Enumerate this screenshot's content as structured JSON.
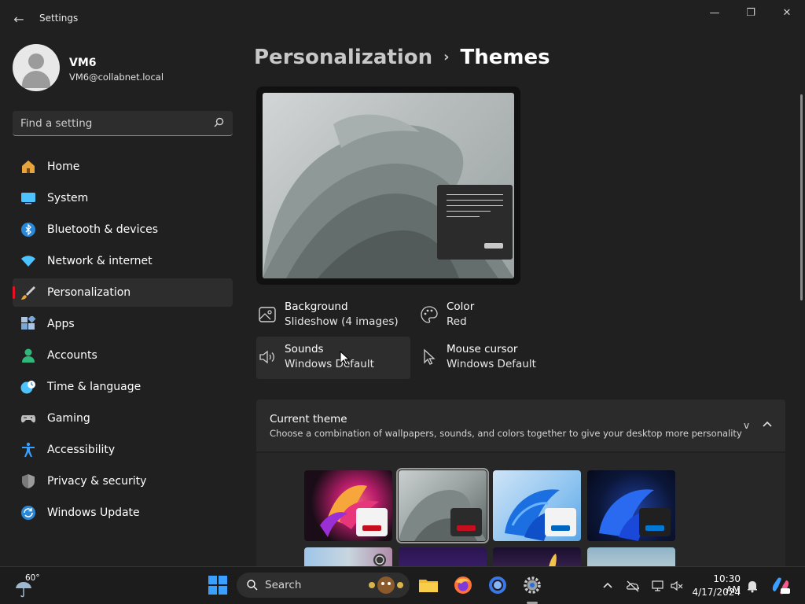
{
  "app": {
    "title": "Settings"
  },
  "window": {
    "minimize": "—",
    "maximize": "❐",
    "close": "✕",
    "back": "←"
  },
  "user": {
    "name": "VM6",
    "email": "VM6@collabnet.local"
  },
  "search": {
    "placeholder": "Find a setting"
  },
  "nav": [
    {
      "label": "Home",
      "icon": "home-icon",
      "color": "#e8a33d"
    },
    {
      "label": "System",
      "icon": "system-icon",
      "color": "#4cc2ff"
    },
    {
      "label": "Bluetooth & devices",
      "icon": "bluetooth-icon",
      "color": "#2b88d8"
    },
    {
      "label": "Network & internet",
      "icon": "wifi-icon",
      "color": "#4cc2ff"
    },
    {
      "label": "Personalization",
      "icon": "paintbrush-icon",
      "color": "#e8a33d",
      "active": true
    },
    {
      "label": "Apps",
      "icon": "apps-icon",
      "color": "#7aa7d8"
    },
    {
      "label": "Accounts",
      "icon": "accounts-icon",
      "color": "#2fb87a"
    },
    {
      "label": "Time & language",
      "icon": "clock-globe-icon",
      "color": "#4cc2ff"
    },
    {
      "label": "Gaming",
      "icon": "gamepad-icon",
      "color": "#bdbdbd"
    },
    {
      "label": "Accessibility",
      "icon": "accessibility-icon",
      "color": "#3aa0ff"
    },
    {
      "label": "Privacy & security",
      "icon": "shield-icon",
      "color": "#9a9a9a"
    },
    {
      "label": "Windows Update",
      "icon": "update-icon",
      "color": "#2b88d8"
    }
  ],
  "breadcrumb": {
    "parent": "Personalization",
    "separator": "›",
    "current": "Themes"
  },
  "tiles": [
    {
      "name": "Background",
      "value": "Slideshow (4 images)",
      "icon": "image-icon"
    },
    {
      "name": "Color",
      "value": "Red",
      "icon": "palette-icon"
    },
    {
      "name": "Sounds",
      "value": "Windows Default",
      "icon": "speaker-icon"
    },
    {
      "name": "Mouse cursor",
      "value": "Windows Default",
      "icon": "cursor-icon"
    }
  ],
  "current_theme": {
    "title": "Current theme",
    "subtitle": "Choose a combination of wallpapers, sounds, and colors together to give your desktop more personality",
    "shortcut": "v"
  },
  "accent_color": "#c50f1f",
  "taskbar": {
    "weather_temp": "60°",
    "search_label": "Search",
    "time": "10:30 AM",
    "date": "4/17/2024"
  }
}
